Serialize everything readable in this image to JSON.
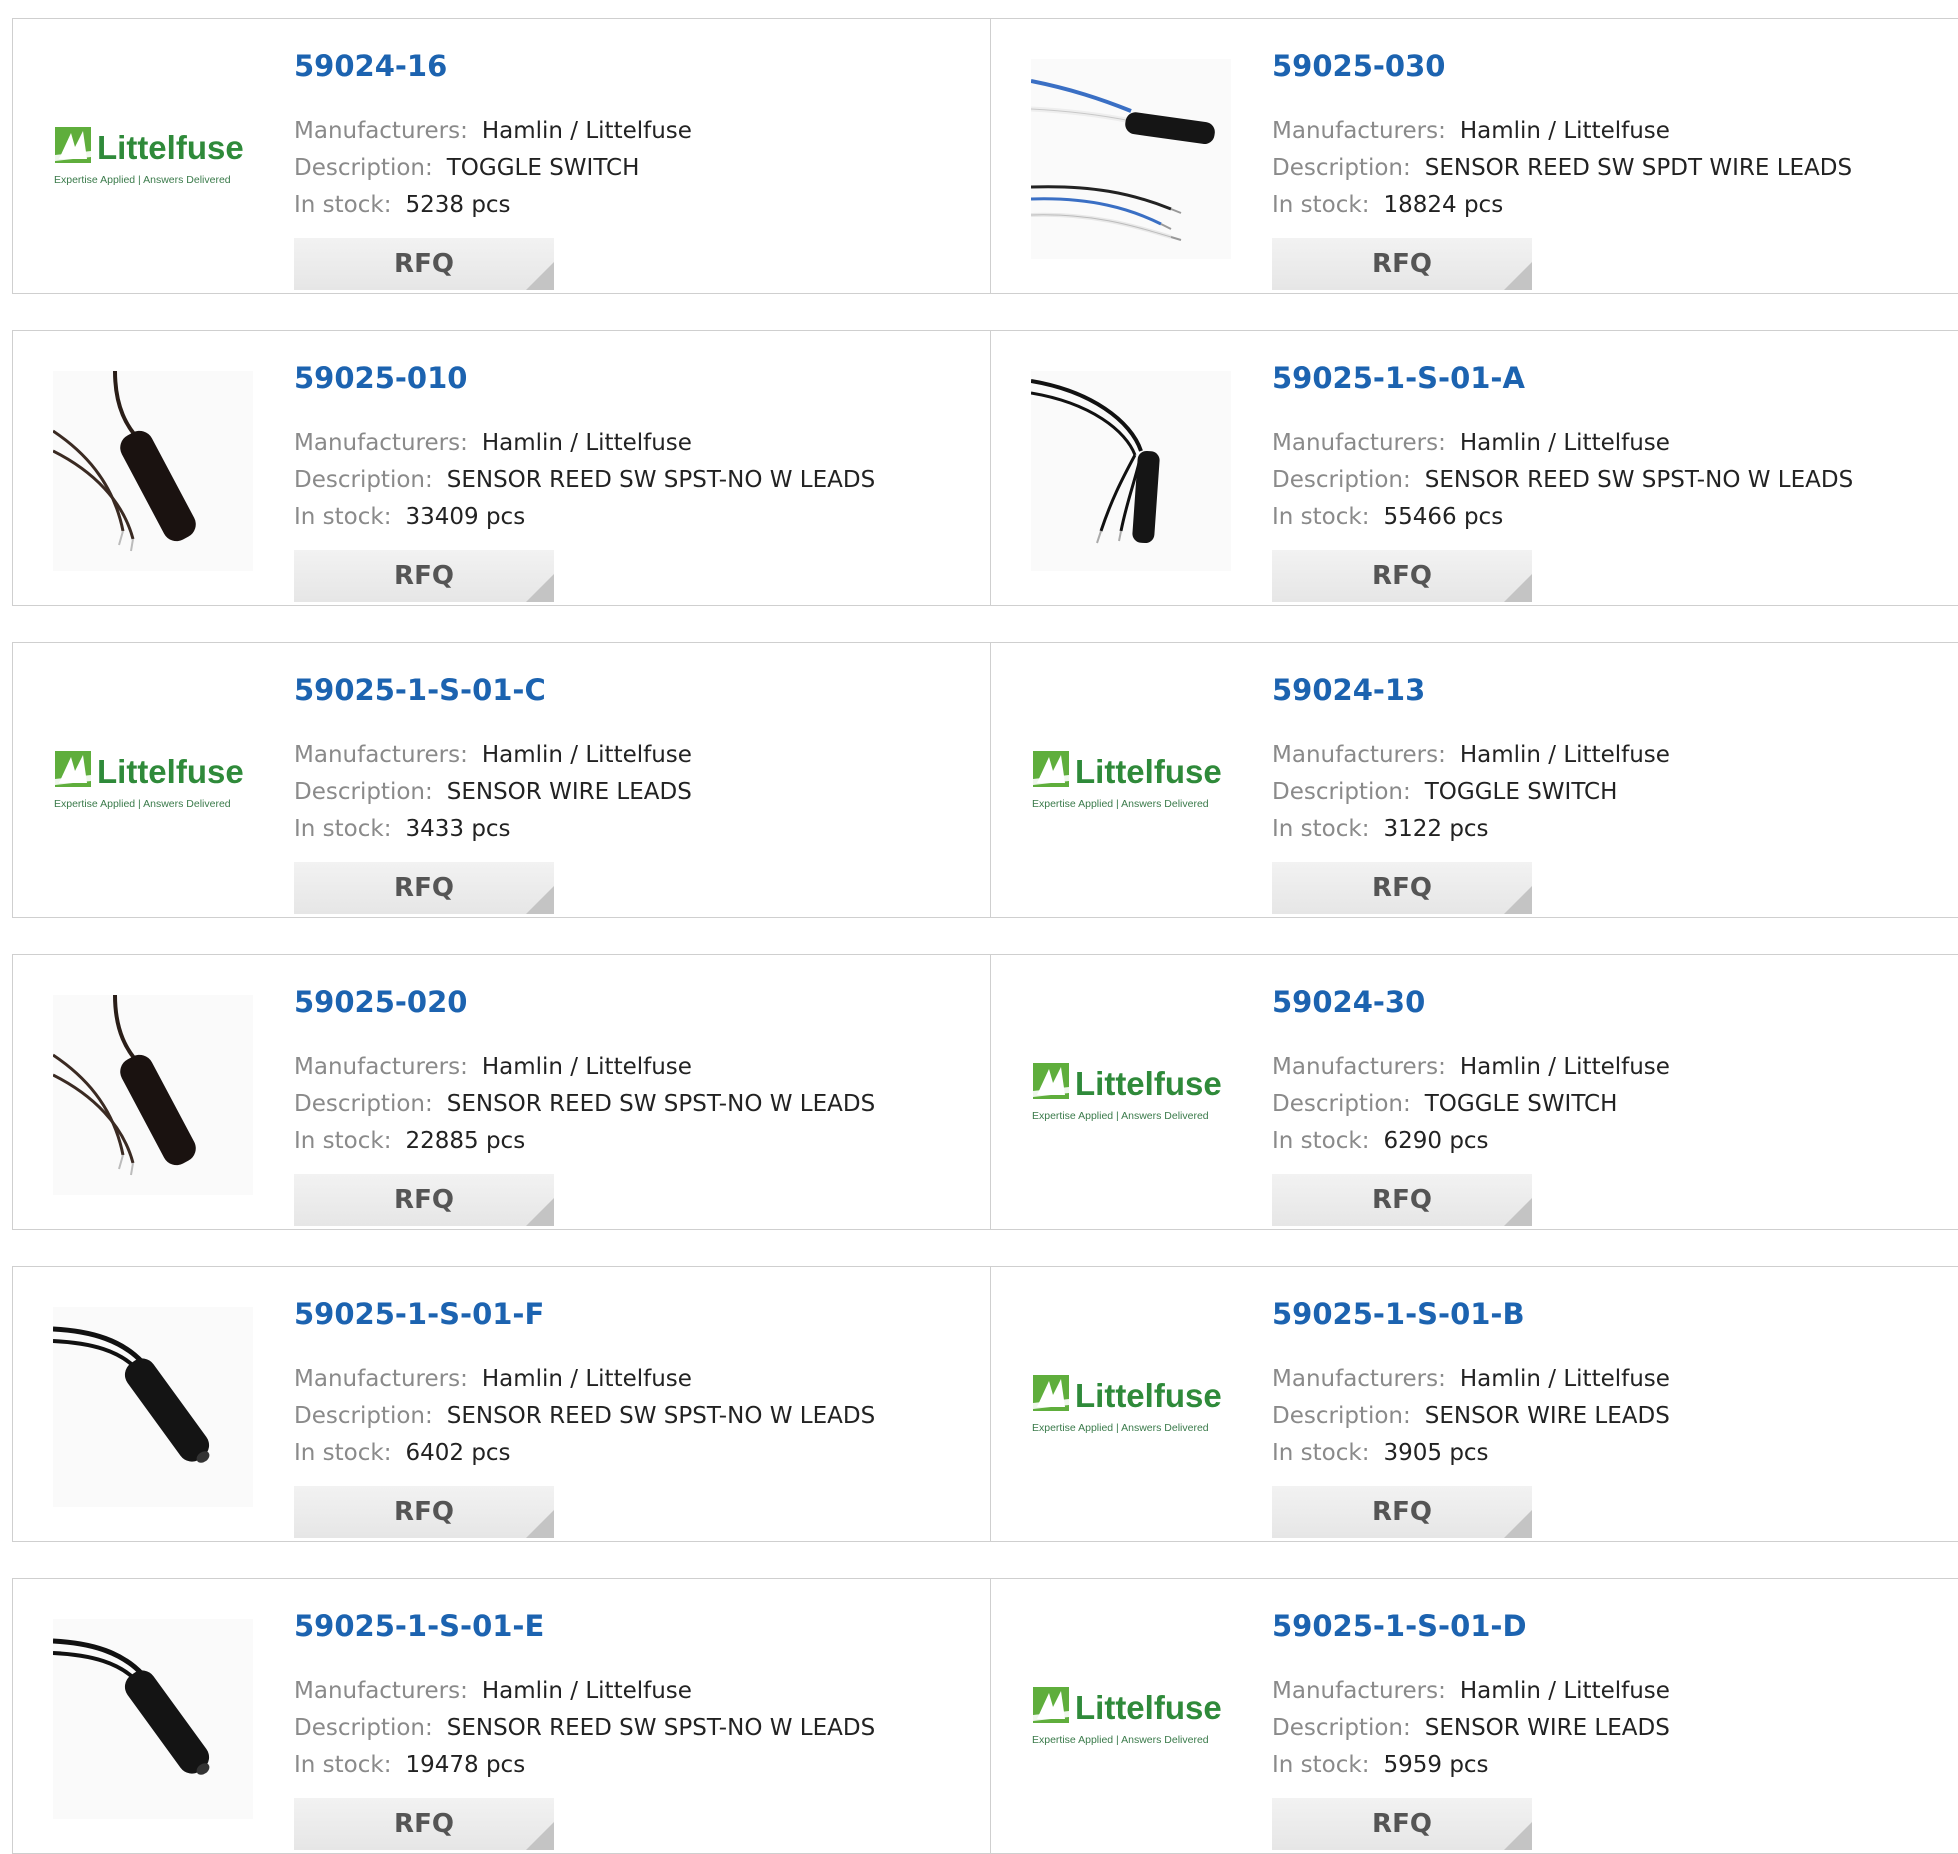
{
  "labels": {
    "manufacturers": "Manufacturers:",
    "description": "Description:",
    "in_stock": "In stock:",
    "rfq": "RFQ"
  },
  "brand": {
    "logo_text": "Littelfuse",
    "tagline": "Expertise Applied | Answers Delivered",
    "logo_green": "#5fae3c",
    "text_green": "#2f8a3a"
  },
  "colors": {
    "part_link": "#1c63b0",
    "label_gray": "#8a8a8a",
    "border": "#cfcfcf",
    "rfq_bg": "#ececec"
  },
  "products": [
    {
      "part": "59024-16",
      "manufacturer": "Hamlin / Littelfuse",
      "description": "TOGGLE SWITCH",
      "stock": "5238 pcs",
      "image": "littelfuse-logo"
    },
    {
      "part": "59025-030",
      "manufacturer": "Hamlin / Littelfuse",
      "description": "SENSOR REED SW SPDT WIRE LEADS",
      "stock": "18824 pcs",
      "image": "reed-sensor-spdt-wires"
    },
    {
      "part": "59025-010",
      "manufacturer": "Hamlin / Littelfuse",
      "description": "SENSOR REED SW SPST-NO W LEADS",
      "stock": "33409 pcs",
      "image": "reed-sensor-brown-leads"
    },
    {
      "part": "59025-1-S-01-A",
      "manufacturer": "Hamlin / Littelfuse",
      "description": "SENSOR REED SW SPST-NO W LEADS",
      "stock": "55466 pcs",
      "image": "reed-sensor-black-leads"
    },
    {
      "part": "59025-1-S-01-C",
      "manufacturer": "Hamlin / Littelfuse",
      "description": "SENSOR WIRE LEADS",
      "stock": "3433 pcs",
      "image": "littelfuse-logo"
    },
    {
      "part": "59024-13",
      "manufacturer": "Hamlin / Littelfuse",
      "description": "TOGGLE SWITCH",
      "stock": "3122 pcs",
      "image": "littelfuse-logo"
    },
    {
      "part": "59025-020",
      "manufacturer": "Hamlin / Littelfuse",
      "description": "SENSOR REED SW SPST-NO W LEADS",
      "stock": "22885 pcs",
      "image": "reed-sensor-brown-leads"
    },
    {
      "part": "59024-30",
      "manufacturer": "Hamlin / Littelfuse",
      "description": "TOGGLE SWITCH",
      "stock": "6290 pcs",
      "image": "littelfuse-logo"
    },
    {
      "part": "59025-1-S-01-F",
      "manufacturer": "Hamlin / Littelfuse",
      "description": "SENSOR REED SW SPST-NO W LEADS",
      "stock": "6402 pcs",
      "image": "reed-sensor-diagonal"
    },
    {
      "part": "59025-1-S-01-B",
      "manufacturer": "Hamlin / Littelfuse",
      "description": "SENSOR WIRE LEADS",
      "stock": "3905 pcs",
      "image": "littelfuse-logo"
    },
    {
      "part": "59025-1-S-01-E",
      "manufacturer": "Hamlin / Littelfuse",
      "description": "SENSOR REED SW SPST-NO W LEADS",
      "stock": "19478 pcs",
      "image": "reed-sensor-diagonal"
    },
    {
      "part": "59025-1-S-01-D",
      "manufacturer": "Hamlin / Littelfuse",
      "description": "SENSOR WIRE LEADS",
      "stock": "5959 pcs",
      "image": "littelfuse-logo"
    }
  ]
}
